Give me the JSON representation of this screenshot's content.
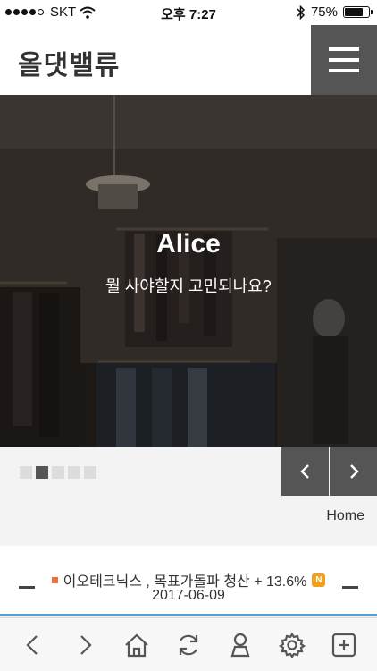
{
  "status_bar": {
    "carrier": "SKT",
    "time": "오후 7:27",
    "battery_percent": "75%",
    "battery_level": 0.75
  },
  "header": {
    "logo": "올댓밸류",
    "menu_icon": "hamburger-menu-icon"
  },
  "hero": {
    "title": "Alice",
    "subtitle": "뭘 사야할지 고민되나요?"
  },
  "slider": {
    "indicator_count": 5,
    "active_index": 1,
    "prev_icon": "chevron-left-icon",
    "next_icon": "chevron-right-icon"
  },
  "breadcrumb": "Home",
  "news": {
    "headline": "이오테크닉스 , 목표가돌파 청산 + 13.6%",
    "badge": "N",
    "date": "2017-06-09"
  },
  "toolbar": {
    "icons": [
      "back-icon",
      "forward-icon",
      "home-icon",
      "refresh-icon",
      "profile-icon",
      "settings-icon",
      "new-tab-icon"
    ]
  },
  "colors": {
    "accent_dark": "#555555",
    "news_bullet": "#e8703a",
    "badge": "#f2a01c",
    "divider_blue": "#4aa3d8"
  }
}
